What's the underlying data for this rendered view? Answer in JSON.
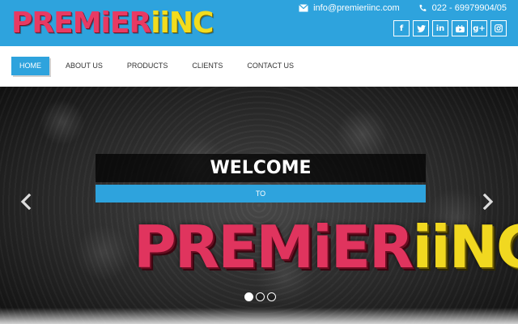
{
  "header": {
    "logo": {
      "part1": "PREMiER",
      "part2": "iiNC"
    },
    "email": "info@premieriinc.com",
    "phone": "022 - 69979904/05",
    "socials": [
      "f",
      "t",
      "in",
      "yt",
      "g+",
      "ig"
    ]
  },
  "nav": {
    "items": [
      "HOME",
      "ABOUT US",
      "PRODUCTS",
      "CLIENTS",
      "CONTACT US"
    ],
    "active_index": 0
  },
  "slider": {
    "welcome": "WELCOME",
    "to": "TO",
    "logo": {
      "part1": "PREMiER",
      "part2": "iiNC"
    },
    "slide_count": 3,
    "active_slide": 1
  },
  "colors": {
    "brand_blue": "#2ea3dd",
    "logo_red": "#e0345e",
    "logo_yellow": "#f1d820"
  },
  "icons": {
    "email": "envelope-icon",
    "phone": "phone-icon",
    "facebook": "facebook-icon",
    "twitter": "twitter-icon",
    "linkedin": "linkedin-icon",
    "youtube": "youtube-icon",
    "googleplus": "googleplus-icon",
    "instagram": "instagram-icon",
    "prev": "chevron-left-icon",
    "next": "chevron-right-icon"
  }
}
